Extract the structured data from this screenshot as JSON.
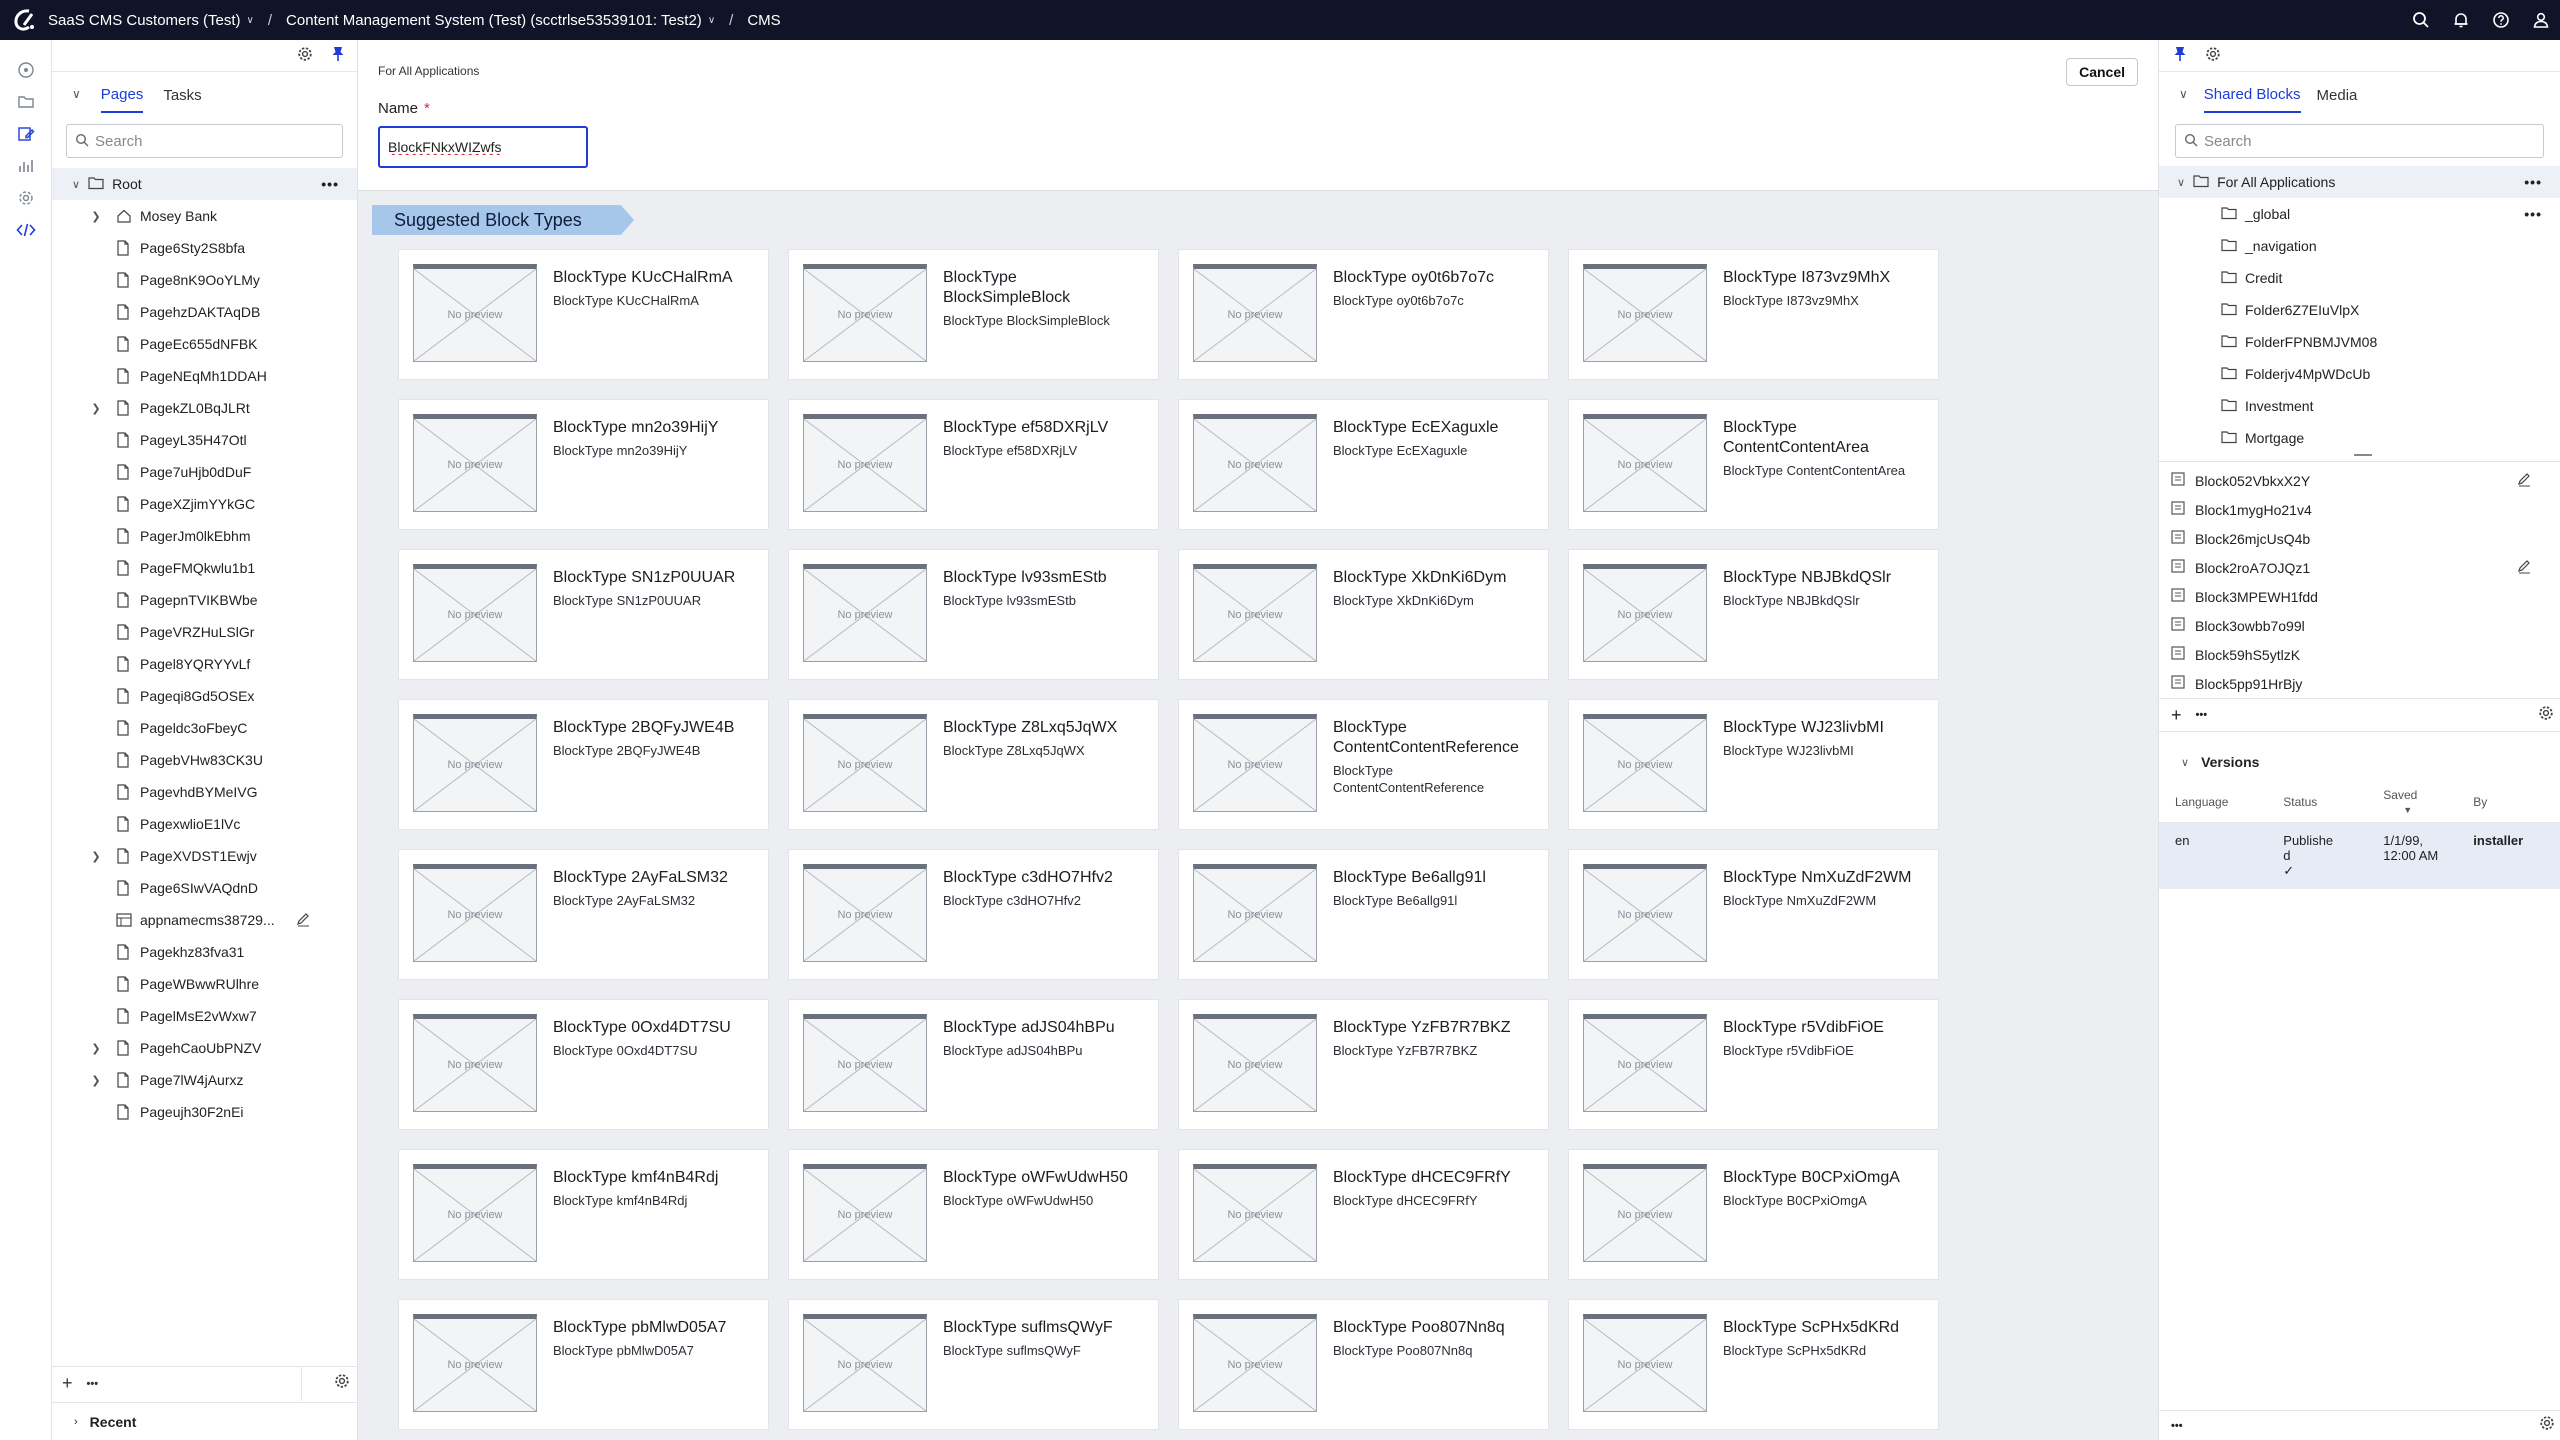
{
  "topbar": {
    "crumbs": [
      {
        "label": "SaaS CMS Customers (Test)",
        "dropdown": true
      },
      {
        "label": "Content Management System (Test) (scctrlse53539101: Test2)",
        "dropdown": true
      },
      {
        "label": "CMS",
        "dropdown": false
      }
    ],
    "icons": [
      "search-icon",
      "bell-icon",
      "help-icon",
      "user-icon"
    ]
  },
  "rail_icons": [
    "dashboard-icon",
    "folder-icon",
    "edit-icon",
    "reports-icon",
    "settings-icon",
    "code-icon"
  ],
  "tree": {
    "tabs": [
      "Pages",
      "Tasks"
    ],
    "search_placeholder": "Search",
    "root": "Root",
    "items": [
      {
        "label": "Mosey Bank",
        "expand": true,
        "icon": "home"
      },
      {
        "label": "Page6Sty2S8bfa",
        "expand": false,
        "icon": "page"
      },
      {
        "label": "Page8nK9OoYLMy",
        "expand": false,
        "icon": "page"
      },
      {
        "label": "PagehzDAKTAqDB",
        "expand": false,
        "icon": "page"
      },
      {
        "label": "PageEc655dNFBK",
        "expand": false,
        "icon": "page"
      },
      {
        "label": "PageNEqMh1DDAH",
        "expand": false,
        "icon": "page"
      },
      {
        "label": "PagekZL0BqJLRt",
        "expand": true,
        "icon": "page"
      },
      {
        "label": "PageyL35H47Otl",
        "expand": false,
        "icon": "page"
      },
      {
        "label": "Page7uHjb0dDuF",
        "expand": false,
        "icon": "page"
      },
      {
        "label": "PageXZjimYYkGC",
        "expand": false,
        "icon": "page"
      },
      {
        "label": "PagerJm0lkEbhm",
        "expand": false,
        "icon": "page"
      },
      {
        "label": "PageFMQkwlu1b1",
        "expand": false,
        "icon": "page"
      },
      {
        "label": "PagepnTVIKBWbe",
        "expand": false,
        "icon": "page"
      },
      {
        "label": "PageVRZHuLSlGr",
        "expand": false,
        "icon": "page"
      },
      {
        "label": "Pagel8YQRYYvLf",
        "expand": false,
        "icon": "page"
      },
      {
        "label": "Pageqi8Gd5OSEx",
        "expand": false,
        "icon": "page"
      },
      {
        "label": "Pageldc3oFbeyC",
        "expand": false,
        "icon": "page"
      },
      {
        "label": "PagebVHw83CK3U",
        "expand": false,
        "icon": "page"
      },
      {
        "label": "PagevhdBYMeIVG",
        "expand": false,
        "icon": "page"
      },
      {
        "label": "PagexwlioE1lVc",
        "expand": false,
        "icon": "page"
      },
      {
        "label": "PageXVDST1Ewjv",
        "expand": true,
        "icon": "page"
      },
      {
        "label": "Page6SIwVAQdnD",
        "expand": false,
        "icon": "page"
      },
      {
        "label": "appnamecms38729...",
        "expand": false,
        "icon": "table",
        "edit": true
      },
      {
        "label": "Pagekhz83fva31",
        "expand": false,
        "icon": "page"
      },
      {
        "label": "PageWBwwRUlhre",
        "expand": false,
        "icon": "page"
      },
      {
        "label": "PagelMsE2vWxw7",
        "expand": false,
        "icon": "page"
      },
      {
        "label": "PagehCaoUbPNZV",
        "expand": true,
        "icon": "page"
      },
      {
        "label": "Page7lW4jAurxz",
        "expand": true,
        "icon": "page"
      },
      {
        "label": "Pageujh30F2nEi",
        "expand": false,
        "icon": "page"
      }
    ],
    "footer_plus": "+",
    "footer_more": "•••",
    "recent": "Recent"
  },
  "main": {
    "for_all": "For All Applications",
    "cancel_label": "Cancel",
    "name_label": "Name",
    "name_required": "*",
    "name_value": "BlockFNkxWIZwfs",
    "suggested_title": "Suggested Block Types",
    "preview_label": "No preview",
    "cards": [
      {
        "title": "BlockType KUcCHalRmA",
        "sub": "BlockType KUcCHalRmA"
      },
      {
        "title": "BlockType BlockSimpleBlock",
        "sub": "BlockType BlockSimpleBlock"
      },
      {
        "title": "BlockType oy0t6b7o7c",
        "sub": "BlockType oy0t6b7o7c"
      },
      {
        "title": "BlockType I873vz9MhX",
        "sub": "BlockType I873vz9MhX"
      },
      {
        "title": "BlockType mn2o39HijY",
        "sub": "BlockType mn2o39HijY"
      },
      {
        "title": "BlockType ef58DXRjLV",
        "sub": "BlockType ef58DXRjLV"
      },
      {
        "title": "BlockType EcEXaguxle",
        "sub": "BlockType EcEXaguxle"
      },
      {
        "title": "BlockType ContentContentArea",
        "sub": "BlockType ContentContentArea"
      },
      {
        "title": "BlockType SN1zP0UUAR",
        "sub": "BlockType SN1zP0UUAR"
      },
      {
        "title": "BlockType lv93smEStb",
        "sub": "BlockType lv93smEStb"
      },
      {
        "title": "BlockType XkDnKi6Dym",
        "sub": "BlockType XkDnKi6Dym"
      },
      {
        "title": "BlockType NBJBkdQSlr",
        "sub": "BlockType NBJBkdQSlr"
      },
      {
        "title": "BlockType 2BQFyJWE4B",
        "sub": "BlockType 2BQFyJWE4B"
      },
      {
        "title": "BlockType Z8Lxq5JqWX",
        "sub": "BlockType Z8Lxq5JqWX"
      },
      {
        "title": "BlockType ContentContentReference",
        "sub": "BlockType ContentContentReference"
      },
      {
        "title": "BlockType WJ23livbMI",
        "sub": "BlockType WJ23livbMI"
      },
      {
        "title": "BlockType 2AyFaLSM32",
        "sub": "BlockType 2AyFaLSM32"
      },
      {
        "title": "BlockType c3dHO7Hfv2",
        "sub": "BlockType c3dHO7Hfv2"
      },
      {
        "title": "BlockType Be6allg91l",
        "sub": "BlockType Be6allg91l"
      },
      {
        "title": "BlockType NmXuZdF2WM",
        "sub": "BlockType NmXuZdF2WM"
      },
      {
        "title": "BlockType 0Oxd4DT7SU",
        "sub": "BlockType 0Oxd4DT7SU"
      },
      {
        "title": "BlockType adJS04hBPu",
        "sub": "BlockType adJS04hBPu"
      },
      {
        "title": "BlockType YzFB7R7BKZ",
        "sub": "BlockType YzFB7R7BKZ"
      },
      {
        "title": "BlockType r5VdibFiOE",
        "sub": "BlockType r5VdibFiOE"
      },
      {
        "title": "BlockType kmf4nB4Rdj",
        "sub": "BlockType kmf4nB4Rdj"
      },
      {
        "title": "BlockType oWFwUdwH50",
        "sub": "BlockType oWFwUdwH50"
      },
      {
        "title": "BlockType dHCEC9FRfY",
        "sub": "BlockType dHCEC9FRfY"
      },
      {
        "title": "BlockType B0CPxiOmgA",
        "sub": "BlockType B0CPxiOmgA"
      },
      {
        "title": "BlockType pbMlwD05A7",
        "sub": "BlockType pbMlwD05A7"
      },
      {
        "title": "BlockType suflmsQWyF",
        "sub": "BlockType suflmsQWyF"
      },
      {
        "title": "BlockType Poo807Nn8q",
        "sub": "BlockType Poo807Nn8q"
      },
      {
        "title": "BlockType ScPHx5dKRd",
        "sub": "BlockType ScPHx5dKRd"
      }
    ]
  },
  "right": {
    "tabs": [
      "Shared Blocks",
      "Media"
    ],
    "search_placeholder": "Search",
    "folder_root": "For All Applications",
    "folders": [
      "_global",
      "_navigation",
      "Credit",
      "Folder6Z7EIuVlpX",
      "FolderFPNBMJVM08",
      "Folderjv4MpWDcUb",
      "Investment",
      "Mortgage"
    ],
    "blocks": [
      {
        "label": "Block052VbkxX2Y",
        "edit": true
      },
      {
        "label": "Block1mygHo21v4",
        "edit": false
      },
      {
        "label": "Block26mjcUsQ4b",
        "edit": false
      },
      {
        "label": "Block2roA7OJQz1",
        "edit": true
      },
      {
        "label": "Block3MPEWH1fdd",
        "edit": false
      },
      {
        "label": "Block3owbb7o99l",
        "edit": false
      },
      {
        "label": "Block59hS5ytlzK",
        "edit": false
      },
      {
        "label": "Block5pp91HrBjy",
        "edit": false
      }
    ],
    "versions": {
      "title": "Versions",
      "headers": [
        "Language",
        "Status",
        "Saved",
        "By"
      ],
      "row": {
        "language": "en",
        "status": "Publishe d",
        "saved": "1/1/99, 12:00 AM",
        "by": "installer"
      }
    }
  }
}
